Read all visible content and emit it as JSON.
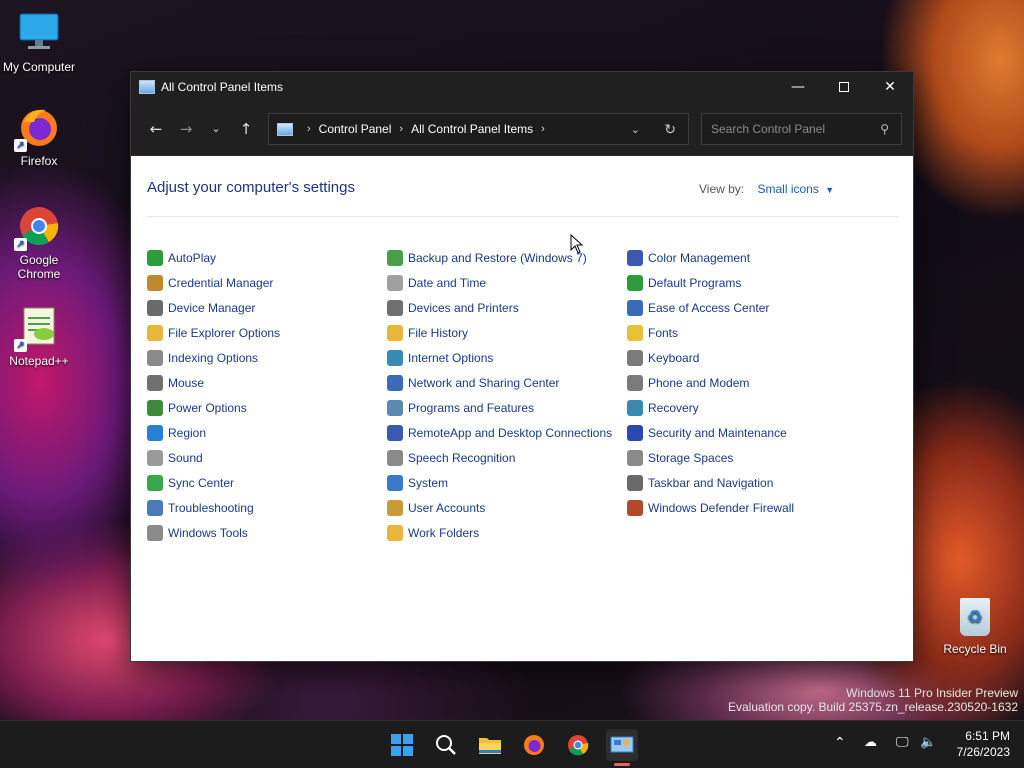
{
  "desktop": {
    "icons": [
      {
        "label": "My Computer"
      },
      {
        "label": "Firefox"
      },
      {
        "label": "Google Chrome"
      },
      {
        "label": "Notepad++"
      }
    ],
    "recycle_bin": {
      "label": "Recycle Bin"
    },
    "watermark": {
      "line1": "Windows 11 Pro Insider Preview",
      "line2": "Evaluation copy. Build 25375.zn_release.230520-1632"
    }
  },
  "window": {
    "title": "All Control Panel Items",
    "breadcrumb": [
      "Control Panel",
      "All Control Panel Items"
    ],
    "search_placeholder": "Search Control Panel",
    "heading": "Adjust your computer's settings",
    "view_by_label": "View by:",
    "view_by_value": "Small icons",
    "columns": [
      [
        {
          "label": "AutoPlay",
          "icon": "autoplay-icon",
          "color": "#2e9b3c"
        },
        {
          "label": "Credential Manager",
          "icon": "credential-icon",
          "color": "#c08a2a"
        },
        {
          "label": "Device Manager",
          "icon": "device-manager-icon",
          "color": "#6a6a6a"
        },
        {
          "label": "File Explorer Options",
          "icon": "folder-options-icon",
          "color": "#e8b63a"
        },
        {
          "label": "Indexing Options",
          "icon": "indexing-icon",
          "color": "#8a8a8a"
        },
        {
          "label": "Mouse",
          "icon": "mouse-icon",
          "color": "#707070"
        },
        {
          "label": "Power Options",
          "icon": "power-icon",
          "color": "#3c8a3a"
        },
        {
          "label": "Region",
          "icon": "region-icon",
          "color": "#2a7fd4"
        },
        {
          "label": "Sound",
          "icon": "sound-icon",
          "color": "#9a9a9a"
        },
        {
          "label": "Sync Center",
          "icon": "sync-icon",
          "color": "#3aa84a"
        },
        {
          "label": "Troubleshooting",
          "icon": "troubleshooting-icon",
          "color": "#4a7ab8"
        },
        {
          "label": "Windows Tools",
          "icon": "windows-tools-icon",
          "color": "#8a8a8a"
        }
      ],
      [
        {
          "label": "Backup and Restore (Windows 7)",
          "icon": "backup-icon",
          "color": "#4aa04a"
        },
        {
          "label": "Date and Time",
          "icon": "clock-icon",
          "color": "#a0a0a0"
        },
        {
          "label": "Devices and Printers",
          "icon": "printer-icon",
          "color": "#707070"
        },
        {
          "label": "File History",
          "icon": "file-history-icon",
          "color": "#e8b63a"
        },
        {
          "label": "Internet Options",
          "icon": "internet-icon",
          "color": "#3a8ab8"
        },
        {
          "label": "Network and Sharing Center",
          "icon": "network-icon",
          "color": "#3a6ab8"
        },
        {
          "label": "Programs and Features",
          "icon": "programs-icon",
          "color": "#5a8ab0"
        },
        {
          "label": "RemoteApp and Desktop Connections",
          "icon": "remoteapp-icon",
          "color": "#3a5ab0"
        },
        {
          "label": "Speech Recognition",
          "icon": "microphone-icon",
          "color": "#8a8a8a"
        },
        {
          "label": "System",
          "icon": "system-icon",
          "color": "#3a7ac8"
        },
        {
          "label": "User Accounts",
          "icon": "users-icon",
          "color": "#c89a3a"
        },
        {
          "label": "Work Folders",
          "icon": "work-folders-icon",
          "color": "#e8b63a"
        }
      ],
      [
        {
          "label": "Color Management",
          "icon": "color-management-icon",
          "color": "#3a5ab0"
        },
        {
          "label": "Default Programs",
          "icon": "default-programs-icon",
          "color": "#2e9b3c"
        },
        {
          "label": "Ease of Access Center",
          "icon": "ease-of-access-icon",
          "color": "#3a6ab8"
        },
        {
          "label": "Fonts",
          "icon": "fonts-icon",
          "color": "#e8c03a"
        },
        {
          "label": "Keyboard",
          "icon": "keyboard-icon",
          "color": "#7a7a7a"
        },
        {
          "label": "Phone and Modem",
          "icon": "phone-icon",
          "color": "#7a7a7a"
        },
        {
          "label": "Recovery",
          "icon": "recovery-icon",
          "color": "#3a8ab0"
        },
        {
          "label": "Security and Maintenance",
          "icon": "flag-icon",
          "color": "#2a4ab0"
        },
        {
          "label": "Storage Spaces",
          "icon": "storage-icon",
          "color": "#8a8a8a"
        },
        {
          "label": "Taskbar and Navigation",
          "icon": "taskbar-icon",
          "color": "#6a6a6a"
        },
        {
          "label": "Windows Defender Firewall",
          "icon": "firewall-icon",
          "color": "#b04a2a"
        }
      ]
    ]
  },
  "taskbar": {
    "time": "6:51 PM",
    "date": "7/26/2023"
  }
}
